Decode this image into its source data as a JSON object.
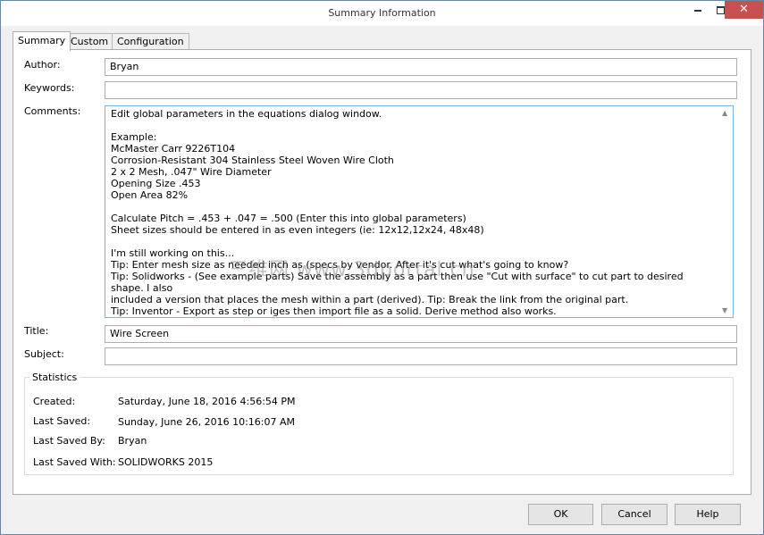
{
  "window": {
    "title": "Summary Information"
  },
  "tabs": [
    "Summary",
    "Custom",
    "Configuration Specific"
  ],
  "fields": {
    "author_label": "Author:",
    "author_value": "Bryan",
    "keywords_label": "Keywords:",
    "keywords_value": "",
    "comments_label": "Comments:",
    "comments_value": "Edit global parameters in the equations dialog window.\n\nExample:\nMcMaster Carr 9226T104\nCorrosion-Resistant 304 Stainless Steel Woven Wire Cloth\n2 x 2 Mesh, .047\" Wire Diameter\nOpening Size .453\nOpen Area 82%\n\nCalculate Pitch = .453 + .047 = .500 (Enter this into global parameters)\nSheet sizes should be entered in as even integers (ie: 12x12,12x24, 48x48)\n\nI'm still working on this...\nTip: Enter mesh size as needed inch as (specs by vendor. After it's cut what's going to know?\nTip: Solidworks - (See example parts) Save the assembly as a part then use \"Cut with surface\" to cut part to desired shape. I also\nincluded a version that places the mesh within a part (derived). Tip: Break the link from the original part.\nTip: Inventor - Export as step or iges then import file as a solid. Derive method also works.",
    "title_label": "Title:",
    "title_value": "Wire Screen",
    "subject_label": "Subject:",
    "subject_value": ""
  },
  "statistics": {
    "heading": "Statistics",
    "rows": [
      {
        "label": "Created:",
        "value": "Saturday, June 18, 2016 4:56:54 PM"
      },
      {
        "label": "Last Saved:",
        "value": "Sunday, June 26, 2016 10:16:07 AM"
      },
      {
        "label": "Last Saved By:",
        "value": "Bryan"
      },
      {
        "label": "Last Saved With:",
        "value": "SOLIDWORKS 2015"
      }
    ]
  },
  "buttons": {
    "ok": "OK",
    "cancel": "Cancel",
    "help": "Help"
  },
  "watermark": "三维网 www.3dportal.cn",
  "colors": {
    "close_button": "#c75050",
    "focus_border": "#7eb4ea"
  }
}
